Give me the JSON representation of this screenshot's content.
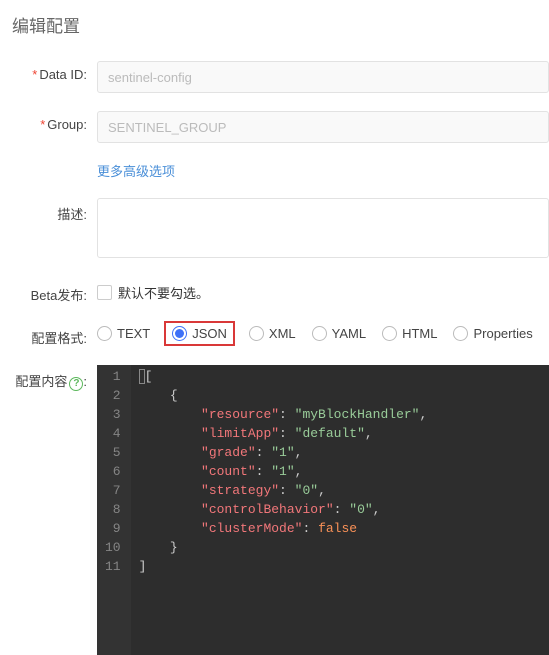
{
  "page": {
    "title": "编辑配置"
  },
  "form": {
    "dataId": {
      "label": "Data ID:",
      "value": "sentinel-config"
    },
    "group": {
      "label": "Group:",
      "value": "SENTINEL_GROUP"
    },
    "advancedLink": "更多高级选项",
    "desc": {
      "label": "描述:",
      "value": ""
    },
    "beta": {
      "label": "Beta发布:",
      "hint": "默认不要勾选。"
    },
    "format": {
      "label": "配置格式:",
      "options": [
        "TEXT",
        "JSON",
        "XML",
        "YAML",
        "HTML",
        "Properties"
      ],
      "selected": "JSON"
    },
    "content": {
      "label": "配置内容"
    }
  },
  "editor": {
    "lineCount": 11,
    "tokens": [
      [
        {
          "t": "[",
          "c": "punc",
          "cursor": true
        }
      ],
      [
        {
          "t": "    {",
          "c": "punc"
        }
      ],
      [
        {
          "t": "        ",
          "c": "punc"
        },
        {
          "t": "\"resource\"",
          "c": "key"
        },
        {
          "t": ": ",
          "c": "punc"
        },
        {
          "t": "\"myBlockHandler\"",
          "c": "str"
        },
        {
          "t": ",",
          "c": "punc"
        }
      ],
      [
        {
          "t": "        ",
          "c": "punc"
        },
        {
          "t": "\"limitApp\"",
          "c": "key"
        },
        {
          "t": ": ",
          "c": "punc"
        },
        {
          "t": "\"default\"",
          "c": "str"
        },
        {
          "t": ",",
          "c": "punc"
        }
      ],
      [
        {
          "t": "        ",
          "c": "punc"
        },
        {
          "t": "\"grade\"",
          "c": "key"
        },
        {
          "t": ": ",
          "c": "punc"
        },
        {
          "t": "\"1\"",
          "c": "str"
        },
        {
          "t": ",",
          "c": "punc"
        }
      ],
      [
        {
          "t": "        ",
          "c": "punc"
        },
        {
          "t": "\"count\"",
          "c": "key"
        },
        {
          "t": ": ",
          "c": "punc"
        },
        {
          "t": "\"1\"",
          "c": "str"
        },
        {
          "t": ",",
          "c": "punc"
        }
      ],
      [
        {
          "t": "        ",
          "c": "punc"
        },
        {
          "t": "\"strategy\"",
          "c": "key"
        },
        {
          "t": ": ",
          "c": "punc"
        },
        {
          "t": "\"0\"",
          "c": "str"
        },
        {
          "t": ",",
          "c": "punc"
        }
      ],
      [
        {
          "t": "        ",
          "c": "punc"
        },
        {
          "t": "\"controlBehavior\"",
          "c": "key"
        },
        {
          "t": ": ",
          "c": "punc"
        },
        {
          "t": "\"0\"",
          "c": "str"
        },
        {
          "t": ",",
          "c": "punc"
        }
      ],
      [
        {
          "t": "        ",
          "c": "punc"
        },
        {
          "t": "\"clusterMode\"",
          "c": "key"
        },
        {
          "t": ": ",
          "c": "punc"
        },
        {
          "t": "false",
          "c": "bool"
        }
      ],
      [
        {
          "t": "    }",
          "c": "punc"
        }
      ],
      [
        {
          "t": "]",
          "c": "punc"
        }
      ]
    ]
  }
}
